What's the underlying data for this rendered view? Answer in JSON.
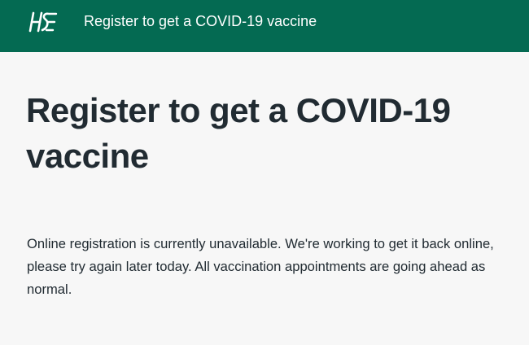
{
  "header": {
    "logo_text": "HSE",
    "title": "Register to get a COVID-19 vaccine"
  },
  "main": {
    "page_title": "Register to get a COVID-19 vaccine",
    "message": "Online registration is currently unavailable. We're working to get it back online, please try again later today. All vaccination appointments are going ahead as normal."
  },
  "colors": {
    "header_bg": "#046a52",
    "page_bg": "#f7f7f7",
    "text": "#212b32",
    "header_text": "#ffffff"
  }
}
